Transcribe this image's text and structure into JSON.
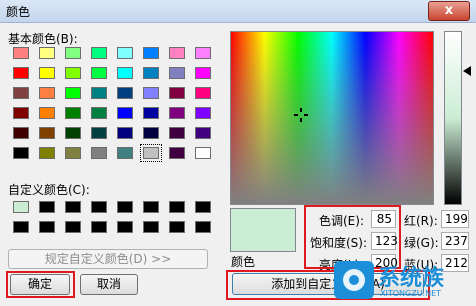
{
  "dialog": {
    "title": "颜色",
    "close_glyph": "x"
  },
  "basic": {
    "label": "基本颜色(B):",
    "colors": [
      [
        "#ff8080",
        "#ffff80",
        "#80ff80",
        "#00ff80",
        "#80ffff",
        "#0080ff",
        "#ff80c0",
        "#ff80ff"
      ],
      [
        "#ff0000",
        "#ffff00",
        "#80ff00",
        "#00ff40",
        "#00ffff",
        "#0080c0",
        "#8080c0",
        "#ff00ff"
      ],
      [
        "#804040",
        "#ff8040",
        "#00ff00",
        "#008080",
        "#004080",
        "#8080ff",
        "#800040",
        "#ff0080"
      ],
      [
        "#800000",
        "#ff8000",
        "#008000",
        "#008040",
        "#0000ff",
        "#0000a0",
        "#800080",
        "#8000ff"
      ],
      [
        "#400000",
        "#804000",
        "#004000",
        "#004040",
        "#000080",
        "#000040",
        "#400040",
        "#400080"
      ],
      [
        "#000000",
        "#808000",
        "#808040",
        "#808080",
        "#408080",
        "#c0c0c0",
        "#400040",
        "#ffffff"
      ]
    ]
  },
  "custom": {
    "label": "自定义颜色(C):",
    "colors": [
      [
        "#cbedd4",
        "#000000",
        "#000000",
        "#000000",
        "#000000",
        "#000000",
        "#000000",
        "#000000"
      ],
      [
        "#000000",
        "#000000",
        "#000000",
        "#000000",
        "#000000",
        "#000000",
        "#000000",
        "#000000"
      ]
    ]
  },
  "buttons": {
    "define_custom": "规定自定义颜色(D) >>",
    "ok": "确定",
    "cancel": "取消",
    "add_custom": "添加到自定义颜色(A)"
  },
  "picker": {
    "preview_color": "#cbedd4",
    "color_solid_label": "颜色",
    "hue_label": "色调(E):",
    "hue_value": "85",
    "sat_label": "饱和度(S):",
    "sat_value": "123",
    "lum_label": "亮度(L):",
    "lum_value": "200",
    "red_label": "红(R):",
    "red_value": "199",
    "green_label": "绿(G):",
    "green_value": "237",
    "blue_label": "蓝(U):",
    "blue_value": "212"
  },
  "watermark": {
    "text": "系统族",
    "url": "XITONGZU.NET",
    "accent": "#1d8fd8"
  },
  "highlight_color": "#e0191f"
}
